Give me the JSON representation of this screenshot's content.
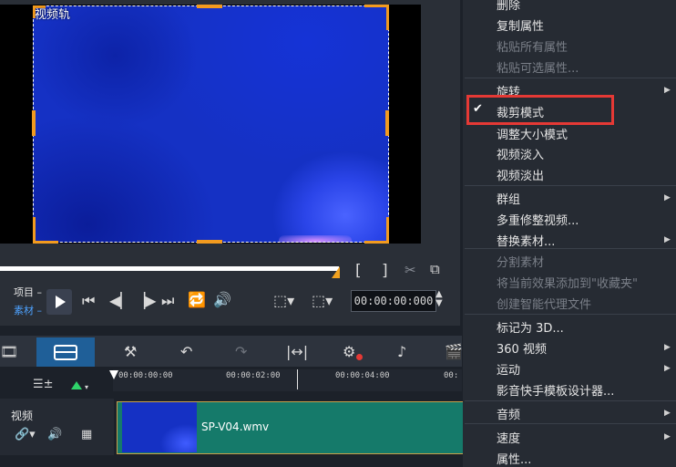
{
  "preview": {
    "track_label": "视频轨",
    "mode_project": "项目",
    "mode_clip": "素材",
    "timecode": "00:00:00:000"
  },
  "timeline": {
    "ruler_ticks": [
      "00:00:00:00",
      "00:00:02:00",
      "00:00:04:00",
      "00:"
    ],
    "track_name": "视频",
    "clip_name": "SP-V04.wmv"
  },
  "context_menu": {
    "items": [
      {
        "label": "删除",
        "enabled": true
      },
      {
        "label": "复制属性",
        "enabled": true
      },
      {
        "label": "粘贴所有属性",
        "enabled": false
      },
      {
        "label": "粘贴可选属性...",
        "enabled": false
      },
      {
        "label": "旋转",
        "enabled": true,
        "submenu": true
      },
      {
        "label": "裁剪模式",
        "enabled": true,
        "checked": true
      },
      {
        "label": "调整大小模式",
        "enabled": true
      },
      {
        "label": "视频淡入",
        "enabled": true
      },
      {
        "label": "视频淡出",
        "enabled": true
      },
      {
        "label": "群组",
        "enabled": true,
        "submenu": true
      },
      {
        "label": "多重修整视频...",
        "enabled": true
      },
      {
        "label": "替换素材...",
        "enabled": true,
        "submenu": true
      },
      {
        "label": "分割素材",
        "enabled": false
      },
      {
        "label": "将当前效果添加到\"收藏夹\"",
        "enabled": false
      },
      {
        "label": "创建智能代理文件",
        "enabled": false
      },
      {
        "label": "标记为 3D...",
        "enabled": true
      },
      {
        "label": "360 视频",
        "enabled": true,
        "submenu": true
      },
      {
        "label": "运动",
        "enabled": true,
        "submenu": true
      },
      {
        "label": "影音快手模板设计器...",
        "enabled": true
      },
      {
        "label": "音频",
        "enabled": true,
        "submenu": true
      },
      {
        "label": "速度",
        "enabled": true,
        "submenu": true
      },
      {
        "label": "属性...",
        "enabled": true
      }
    ]
  },
  "colors": {
    "accent_orange": "#f29b1f",
    "highlight_red": "#e53935",
    "clip_teal": "#157a6a",
    "active_blue": "#1f5f98"
  }
}
